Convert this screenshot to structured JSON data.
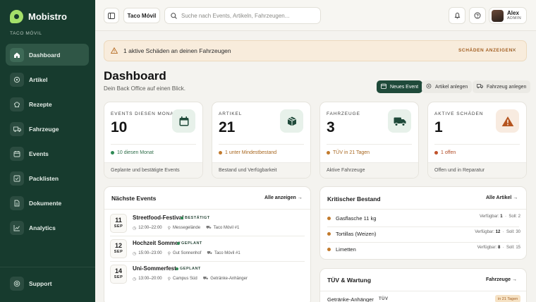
{
  "app": {
    "name": "Mobistro",
    "tenant_label": "TACO MÓVIL"
  },
  "sidebar": {
    "items": [
      {
        "label": "Dashboard",
        "icon": "home-icon",
        "active": true
      },
      {
        "label": "Artikel",
        "icon": "tag-icon",
        "active": false
      },
      {
        "label": "Rezepte",
        "icon": "chef-hat-icon",
        "active": false
      },
      {
        "label": "Fahrzeuge",
        "icon": "truck-icon",
        "active": false
      },
      {
        "label": "Events",
        "icon": "calendar-icon",
        "active": false
      },
      {
        "label": "Packlisten",
        "icon": "checklist-icon",
        "active": false
      },
      {
        "label": "Dokumente",
        "icon": "document-icon",
        "active": false
      },
      {
        "label": "Analytics",
        "icon": "chart-line-icon",
        "active": false
      }
    ],
    "support_label": "Support"
  },
  "header": {
    "tenant_button": "Taco Móvil",
    "search_placeholder": "Suche nach Events, Artikeln, Fahrzeugen...",
    "user_name": "Alex",
    "user_role": "ADMIN"
  },
  "alert": {
    "text": "1 aktive Schäden an deinen Fahrzeugen",
    "action": "SCHÄDEN ANZEIGEN"
  },
  "page": {
    "title": "Dashboard",
    "subtitle": "Dein Back Office auf einen Blick.",
    "actions": [
      "Neues Event",
      "Artikel anlegen",
      "Fahrzeug anlegen"
    ]
  },
  "kpis": [
    {
      "label": "EVENTS DIESEN MONAT",
      "value": "10",
      "note": "10 diesen Monat",
      "footer": "Geplante und bestätigte Events",
      "icon": "calendar-icon",
      "note_color": "#2f8a55"
    },
    {
      "label": "ARTIKEL",
      "value": "21",
      "note": "1 unter Mindestbestand",
      "footer": "Bestand und Verfügbarkeit",
      "icon": "box-icon",
      "note_color": "#c27a2c"
    },
    {
      "label": "FAHRZEUGE",
      "value": "3",
      "note": "TÜV in 21 Tagen",
      "footer": "Aktive Fahrzeuge",
      "icon": "truck-icon",
      "note_color": "#c27a2c"
    },
    {
      "label": "AKTIVE SCHÄDEN",
      "value": "1",
      "note": "1 offen",
      "footer": "Offen und in Reparatur",
      "icon": "warning-icon",
      "note_color": "#c0522a"
    }
  ],
  "events_panel": {
    "title": "Nächste Events",
    "link": "Alle anzeigen",
    "events": [
      {
        "day": "11",
        "month": "SEP",
        "name": "Streetfood-Festival",
        "status": "BESTÄTIGT",
        "time": "12:00–22:00",
        "location": "Messegelände",
        "vehicle": "Taco Móvil #1"
      },
      {
        "day": "12",
        "month": "SEP",
        "name": "Hochzeit Sommer",
        "status": "GEPLANT",
        "time": "15:00–23:00",
        "location": "Gut Sonnenhof",
        "vehicle": "Taco Móvil #1"
      },
      {
        "day": "14",
        "month": "SEP",
        "name": "Uni-Sommerfest",
        "status": "GEPLANT",
        "time": "13:00–20:00",
        "location": "Campus Süd",
        "vehicle": "Getränke-Anhänger"
      }
    ]
  },
  "stock_panel": {
    "title": "Kritischer Bestand",
    "link": "Alle Artikel",
    "avail_label": "Verfügbar:",
    "target_label": "Soll:",
    "items": [
      {
        "name": "Gasflasche 11 kg",
        "available": "1",
        "target": "2"
      },
      {
        "name": "Tortillas (Weizen)",
        "available": "12",
        "target": "30"
      },
      {
        "name": "Limetten",
        "available": "8",
        "target": "15"
      }
    ]
  },
  "tuv_panel": {
    "title": "TÜV & Wartung",
    "link": "Fahrzeuge",
    "rows": [
      {
        "name": "Getränke-Anhänger",
        "type": "TÜV",
        "badge": "in 21 Tagen"
      }
    ]
  },
  "colors": {
    "sidebar_bg": "#173b2e",
    "accent": "#1f4a3a",
    "warning": "#c27a2c"
  }
}
